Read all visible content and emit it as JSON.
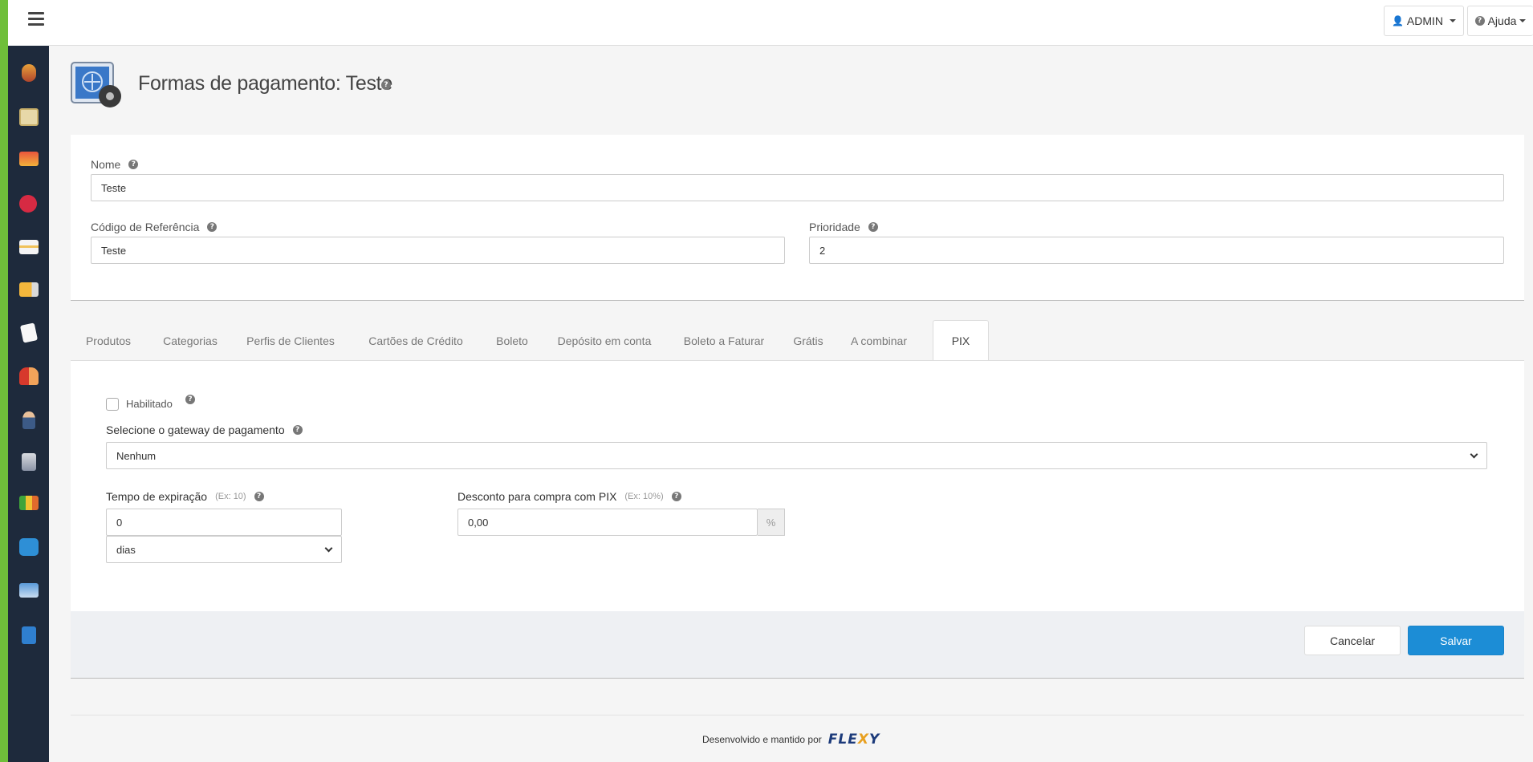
{
  "topbar": {
    "user_label": "ADMIN",
    "help_label": "Ajuda"
  },
  "sidebar": {
    "icons": [
      "db-icon",
      "box-icon",
      "stack-icon",
      "discount-icon",
      "card-icon",
      "truck-icon",
      "document-icon",
      "users-icon",
      "user-icon",
      "server-icon",
      "chart-icon",
      "share-icon",
      "monitor-icon",
      "help-book-icon"
    ]
  },
  "page": {
    "title": "Formas de pagamento: Teste"
  },
  "form": {
    "nome_label": "Nome",
    "nome_value": "Teste",
    "codigo_label": "Código de Referência",
    "codigo_value": "Teste",
    "prioridade_label": "Prioridade",
    "prioridade_value": "2"
  },
  "tabs": [
    "Produtos",
    "Categorias",
    "Perfis de Clientes",
    "Cartões de Crédito",
    "Boleto",
    "Depósito em conta",
    "Boleto a Faturar",
    "Grátis",
    "A combinar",
    "PIX"
  ],
  "active_tab": "PIX",
  "pix": {
    "habilitado_label": "Habilitado",
    "habilitado_checked": false,
    "gateway_label": "Selecione o gateway de pagamento",
    "gateway_value": "Nenhum",
    "tempo_label": "Tempo de expiração",
    "tempo_example": "(Ex: 10)",
    "tempo_value": "0",
    "tempo_unit": "dias",
    "desconto_label": "Desconto para compra com PIX",
    "desconto_example": "(Ex: 10%)",
    "desconto_value": "0,00",
    "desconto_addon": "%"
  },
  "actions": {
    "cancel_label": "Cancelar",
    "save_label": "Salvar"
  },
  "footer": {
    "credit_text": "Desenvolvido e mantido por",
    "brand_a": "FLE",
    "brand_x": "X",
    "brand_b": "Y"
  },
  "colors": {
    "primary": "#1c8dd6",
    "sidebar_bg": "#1e2a3c",
    "accent_green": "#6fbf3a"
  }
}
